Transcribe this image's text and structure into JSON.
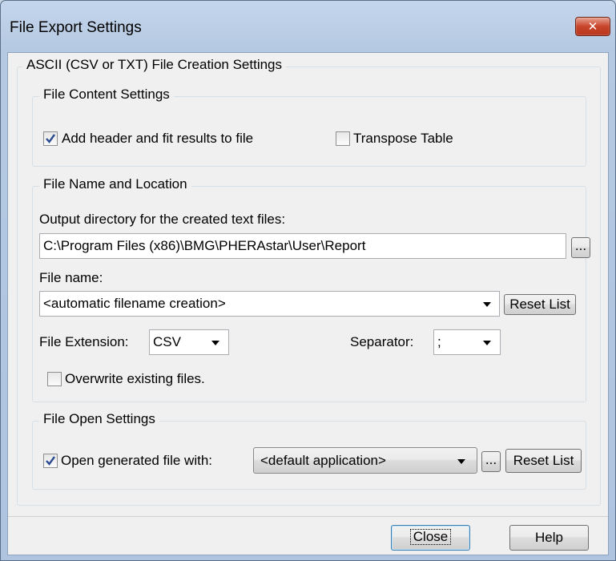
{
  "window": {
    "title": "File Export Settings",
    "close_glyph": "✕"
  },
  "ascii_group": {
    "legend": "ASCII (CSV or TXT) File Creation Settings"
  },
  "content_group": {
    "legend": "File Content Settings",
    "add_header": {
      "label": "Add header and fit results to file",
      "checked": true
    },
    "transpose": {
      "label": "Transpose Table",
      "checked": false
    }
  },
  "location_group": {
    "legend": "File Name and Location",
    "output_dir_label": "Output directory for the created text files:",
    "output_dir_value": "C:\\Program Files (x86)\\BMG\\PHERAstar\\User\\Report",
    "browse_label": "...",
    "file_name_label": "File name:",
    "file_name_value": "<automatic filename creation>",
    "reset_label": "Reset List",
    "extension_label": "File Extension:",
    "extension_value": "CSV",
    "separator_label": "Separator:",
    "separator_value": ";",
    "overwrite": {
      "label": "Overwrite existing files.",
      "checked": false
    }
  },
  "open_group": {
    "legend": "File Open Settings",
    "open_with": {
      "label": "Open generated file with:",
      "checked": true
    },
    "application_value": "<default application>",
    "browse_label": "...",
    "reset_label": "Reset List"
  },
  "footer": {
    "close_label": "Close",
    "help_label": "Help"
  },
  "colors": {
    "accent": "#3c7fb1",
    "close_button": "#c8442a",
    "titlebar": "#b5c9e2"
  }
}
